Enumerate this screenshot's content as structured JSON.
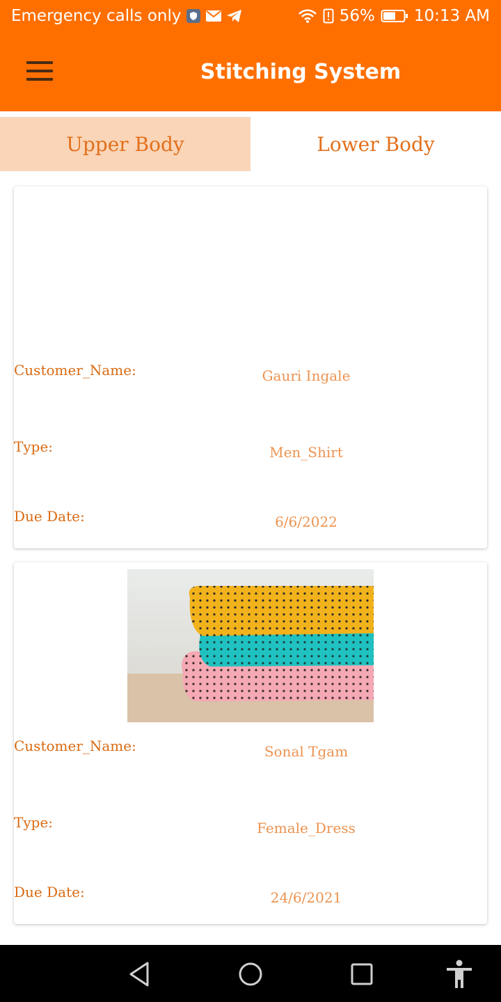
{
  "status_bar": {
    "carrier": "Emergency calls only",
    "battery": "56%",
    "time": "10:13 AM"
  },
  "app_bar": {
    "title": "Stitching System"
  },
  "tabs": [
    {
      "label": "Upper Body",
      "active": true
    },
    {
      "label": "Lower Body",
      "active": false
    }
  ],
  "orders": [
    {
      "customer_label": "Customer_Name:",
      "customer_name": "Gauri Ingale",
      "type_label": "Type:",
      "type": "Men_Shirt",
      "due_label": "Due Date:",
      "due_date": "6/6/2022",
      "has_image": false
    },
    {
      "customer_label": "Customer_Name:",
      "customer_name": "Sonal Tgam",
      "type_label": "Type:",
      "type": "Female_Dress",
      "due_label": "Due Date:",
      "due_date": "24/6/2021",
      "has_image": true
    }
  ],
  "colors": {
    "primary": "#ff6f00",
    "tab_active_bg": "#fad5b8",
    "label": "#d96a12",
    "value": "#ec9350"
  },
  "nav_bar": {
    "icons": [
      "back-icon",
      "home-icon",
      "recents-icon",
      "accessibility-icon"
    ]
  }
}
